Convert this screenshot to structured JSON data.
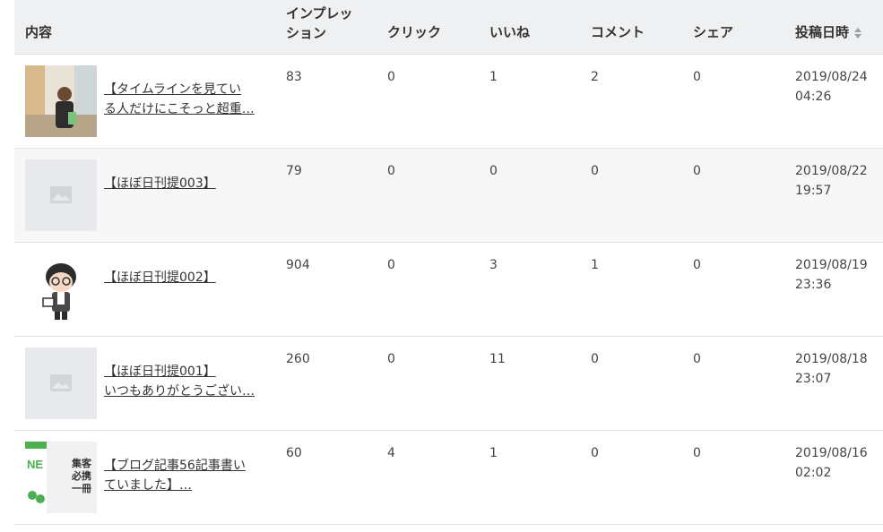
{
  "headers": {
    "content": "内容",
    "impressions": "インプレッ\nション",
    "clicks": "クリック",
    "likes": "いいね",
    "comments": "コメント",
    "shares": "シェア",
    "posted_at": "投稿日時"
  },
  "rows": [
    {
      "title": "【タイムラインを見てい\nる人だけにこそっと超重…",
      "impressions": "83",
      "clicks": "0",
      "likes": "1",
      "comments": "2",
      "shares": "0",
      "date": "2019/08/24\n04:26",
      "thumb": "photo-person"
    },
    {
      "title": "【ほぼ日刊提003】",
      "impressions": "79",
      "clicks": "0",
      "likes": "0",
      "comments": "0",
      "shares": "0",
      "date": "2019/08/22\n19:57",
      "thumb": "placeholder-image-icon"
    },
    {
      "title": "【ほぼ日刊提002】",
      "impressions": "904",
      "clicks": "0",
      "likes": "3",
      "comments": "1",
      "shares": "0",
      "date": "2019/08/19\n23:36",
      "thumb": "avatar-illustration"
    },
    {
      "title": "【ほぼ日刊提001】\nいつもありがとうござい…",
      "impressions": "260",
      "clicks": "0",
      "likes": "11",
      "comments": "0",
      "shares": "0",
      "date": "2019/08/18\n23:07",
      "thumb": "placeholder-image-icon"
    },
    {
      "title": "【ブログ記事56記事書い\nていました】…",
      "impressions": "60",
      "clicks": "4",
      "likes": "1",
      "comments": "0",
      "shares": "0",
      "date": "2019/08/16\n02:02",
      "thumb": "book-cover"
    }
  ],
  "thumb_text": {
    "book_line1": "集客",
    "book_line2": "必携",
    "book_line3": "一冊",
    "book_brand": "NE"
  },
  "colors": {
    "header_bg": "#eef0f2",
    "alt_row_bg": "#f7f7f7",
    "border": "#e1e3e6",
    "accent_green": "#4caf50"
  }
}
